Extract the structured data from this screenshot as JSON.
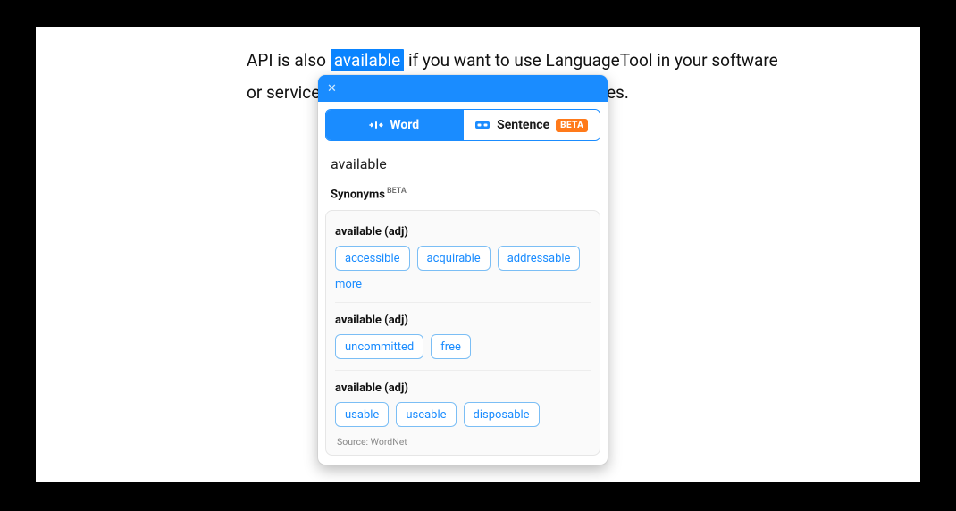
{
  "body": {
    "pre": "API is also ",
    "highlight": "available",
    "mid": " if you want to use LanguageTool in your software or service. A",
    "tail": "ces."
  },
  "popup": {
    "tabs": {
      "word": "Word",
      "sentence": "Sentence",
      "beta": "BETA"
    },
    "lookup": "available",
    "sectionTitle": "Synonyms",
    "sectionBadge": "BETA",
    "senses": [
      {
        "label": "available (adj)",
        "items": [
          "accessible",
          "acquirable",
          "addressable"
        ],
        "more": "more"
      },
      {
        "label": "available (adj)",
        "items": [
          "uncommitted",
          "free"
        ]
      },
      {
        "label": "available (adj)",
        "items": [
          "usable",
          "useable",
          "disposable"
        ]
      }
    ],
    "source": "Source: WordNet"
  },
  "colors": {
    "accent": "#1a8cff",
    "badge": "#ff7a1a"
  }
}
